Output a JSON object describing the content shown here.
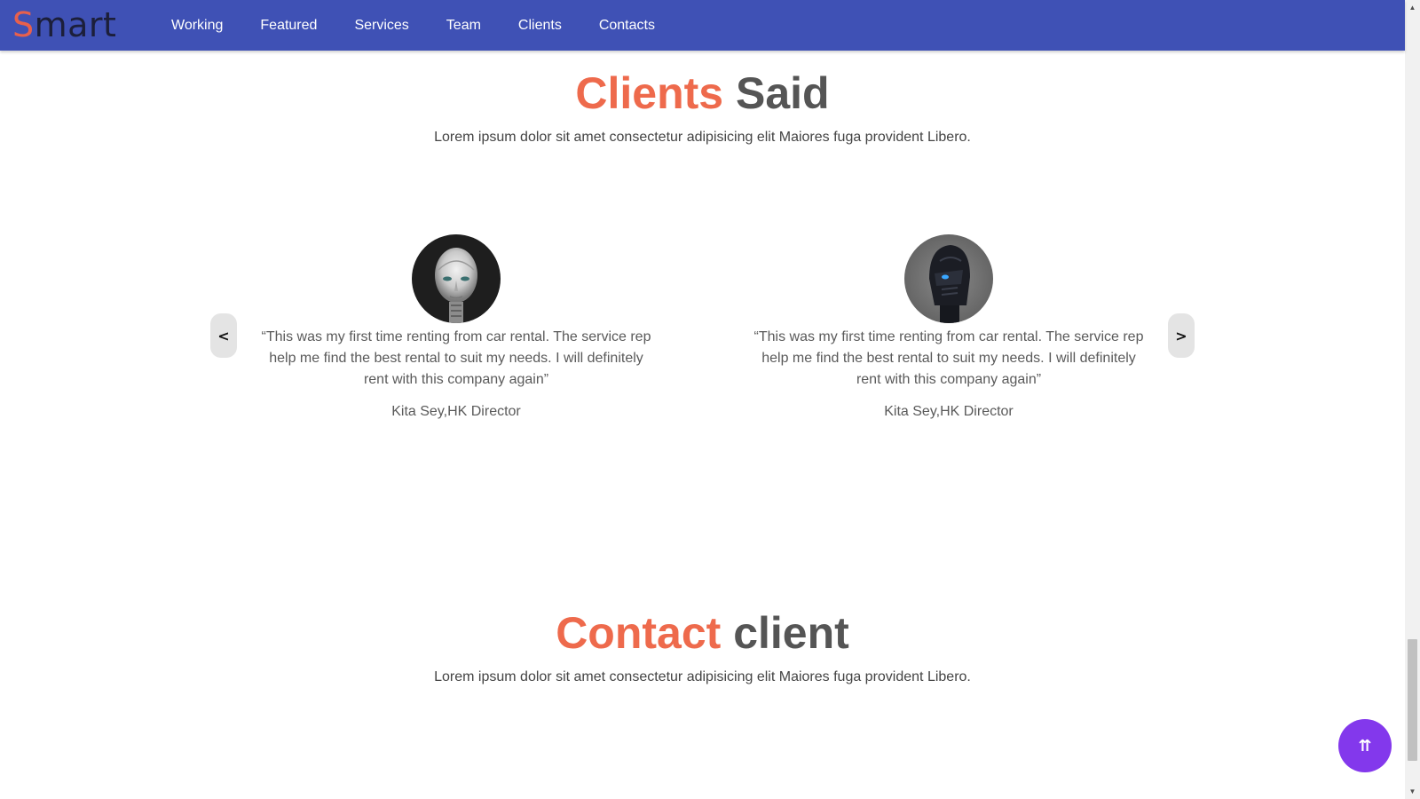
{
  "nav": {
    "logo_first": "S",
    "logo_rest": "mart",
    "links": [
      "Working",
      "Featured",
      "Services",
      "Team",
      "Clients",
      "Contacts"
    ]
  },
  "clients_section": {
    "title_accent": "Clients",
    "title_rest": "Said",
    "subtitle": "Lorem ipsum dolor sit amet consectetur adipisicing elit Maiores fuga provident Libero.",
    "prev_label": "<",
    "next_label": ">",
    "testimonials": [
      {
        "avatar_icon": "silver-android-face-avatar",
        "quote": "“This was my first time renting from car rental. The service rep help me find the best rental to suit my needs. I will definitely rent with this company again”",
        "author": "Kita Sey,HK Director"
      },
      {
        "avatar_icon": "dark-helmet-robot-avatar",
        "quote": "“This was my first time renting from car rental. The service rep help me find the best rental to suit my needs. I will definitely rent with this company again”",
        "author": "Kita Sey,HK Director"
      }
    ]
  },
  "contact_section": {
    "title_accent": "Contact",
    "title_rest": "client",
    "subtitle": "Lorem ipsum dolor sit amet consectetur adipisicing elit Maiores fuga provident Libero."
  },
  "scroll_top": {
    "icon": "double-arrow-up-icon",
    "label": "⇈"
  },
  "colors": {
    "navbar": "#3f51b5",
    "accent": "#ee6a4c",
    "title_gray": "#555555",
    "scroll_top_button": "#8338ec"
  }
}
